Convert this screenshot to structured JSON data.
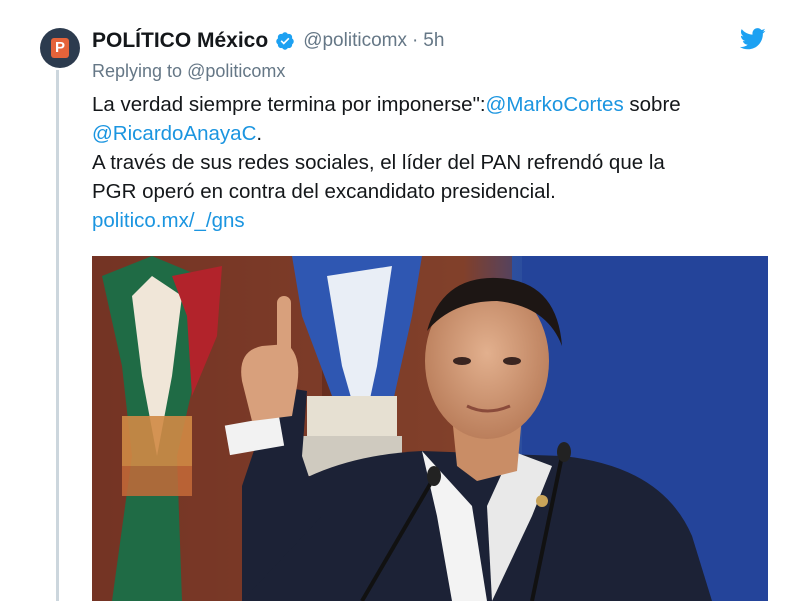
{
  "tweet": {
    "author_name": "POLÍTICO México",
    "handle": "@politicomx",
    "separator": "·",
    "time": "5h",
    "reply_prefix": "Replying to",
    "reply_handle": "@politicomx",
    "line1_text": "La verdad siempre termina por imponerse\":",
    "line1_mention": "@MarkoCortes",
    "line1_connector": " sobre",
    "line2_mention": "@RicardoAnayaC",
    "line2_end": ".",
    "line3": "A través de sus redes sociales, el líder del PAN refrendó que la",
    "line4": "PGR operó en contra del excandidato presidencial.",
    "link": "politico.mx/_/gns"
  },
  "icons": {
    "avatar_logo_letter": "P",
    "verified": "verified-badge-icon",
    "twitter": "twitter-bird-icon"
  },
  "colors": {
    "link": "#1b95e0",
    "muted": "#657786",
    "verified": "#1da1f2",
    "avatar_bg": "#2c3b4e",
    "avatar_logo": "#e5633a"
  }
}
